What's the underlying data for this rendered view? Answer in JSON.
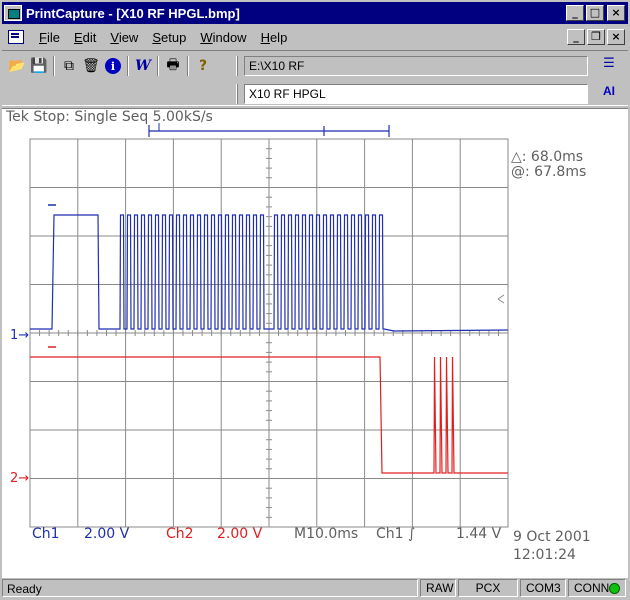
{
  "window": {
    "title": "PrintCapture - [X10 RF HPGL.bmp]",
    "buttons": {
      "minimize": "_",
      "maximize": "□",
      "close": "×"
    }
  },
  "menu": {
    "items": [
      "File",
      "Edit",
      "View",
      "Setup",
      "Window",
      "Help"
    ],
    "mdi_buttons": {
      "minimize": "_",
      "restore": "❐",
      "close": "×"
    }
  },
  "toolbar": {
    "icons": [
      "open-folder-icon",
      "save-icon",
      "copy-icon",
      "clear-icon",
      "info-icon",
      "w-icon",
      "print-icon",
      "help-icon"
    ],
    "glyphs": {
      "open": "📂",
      "save": "💾",
      "copy": "⧉",
      "clear": "🗑",
      "info": "i",
      "w": "W",
      "print": "🖶",
      "help": "?"
    },
    "path": "E:\\X10 RF",
    "name": "X10 RF HPGL",
    "right_glyph_1": "☰",
    "right_glyph_2": "AI"
  },
  "scope": {
    "status": "Tek Stop: Single Seq  5.00kS/s",
    "delta": "△: 68.0ms",
    "at": "@: 67.8ms",
    "ch1_label": "Ch1",
    "ch1_scale": "2.00 V",
    "ch2_label": "Ch2",
    "ch2_scale": "2.00 V",
    "timebase": "M10.0ms",
    "trigger_channel": "Ch1 ∫",
    "trigger_level": "1.44 V",
    "date": "9 Oct 2001",
    "time": "12:01:24",
    "ch1_marker": "1→",
    "ch2_marker": "2→",
    "colors": {
      "ch1": "#1f2fb0",
      "ch2": "#e02020",
      "grid": "#8a8a8a"
    }
  },
  "status_bar": {
    "text": "Ready",
    "raw": "RAW",
    "pcx": "PCX",
    "com": "COM3",
    "conn": "CONN"
  }
}
